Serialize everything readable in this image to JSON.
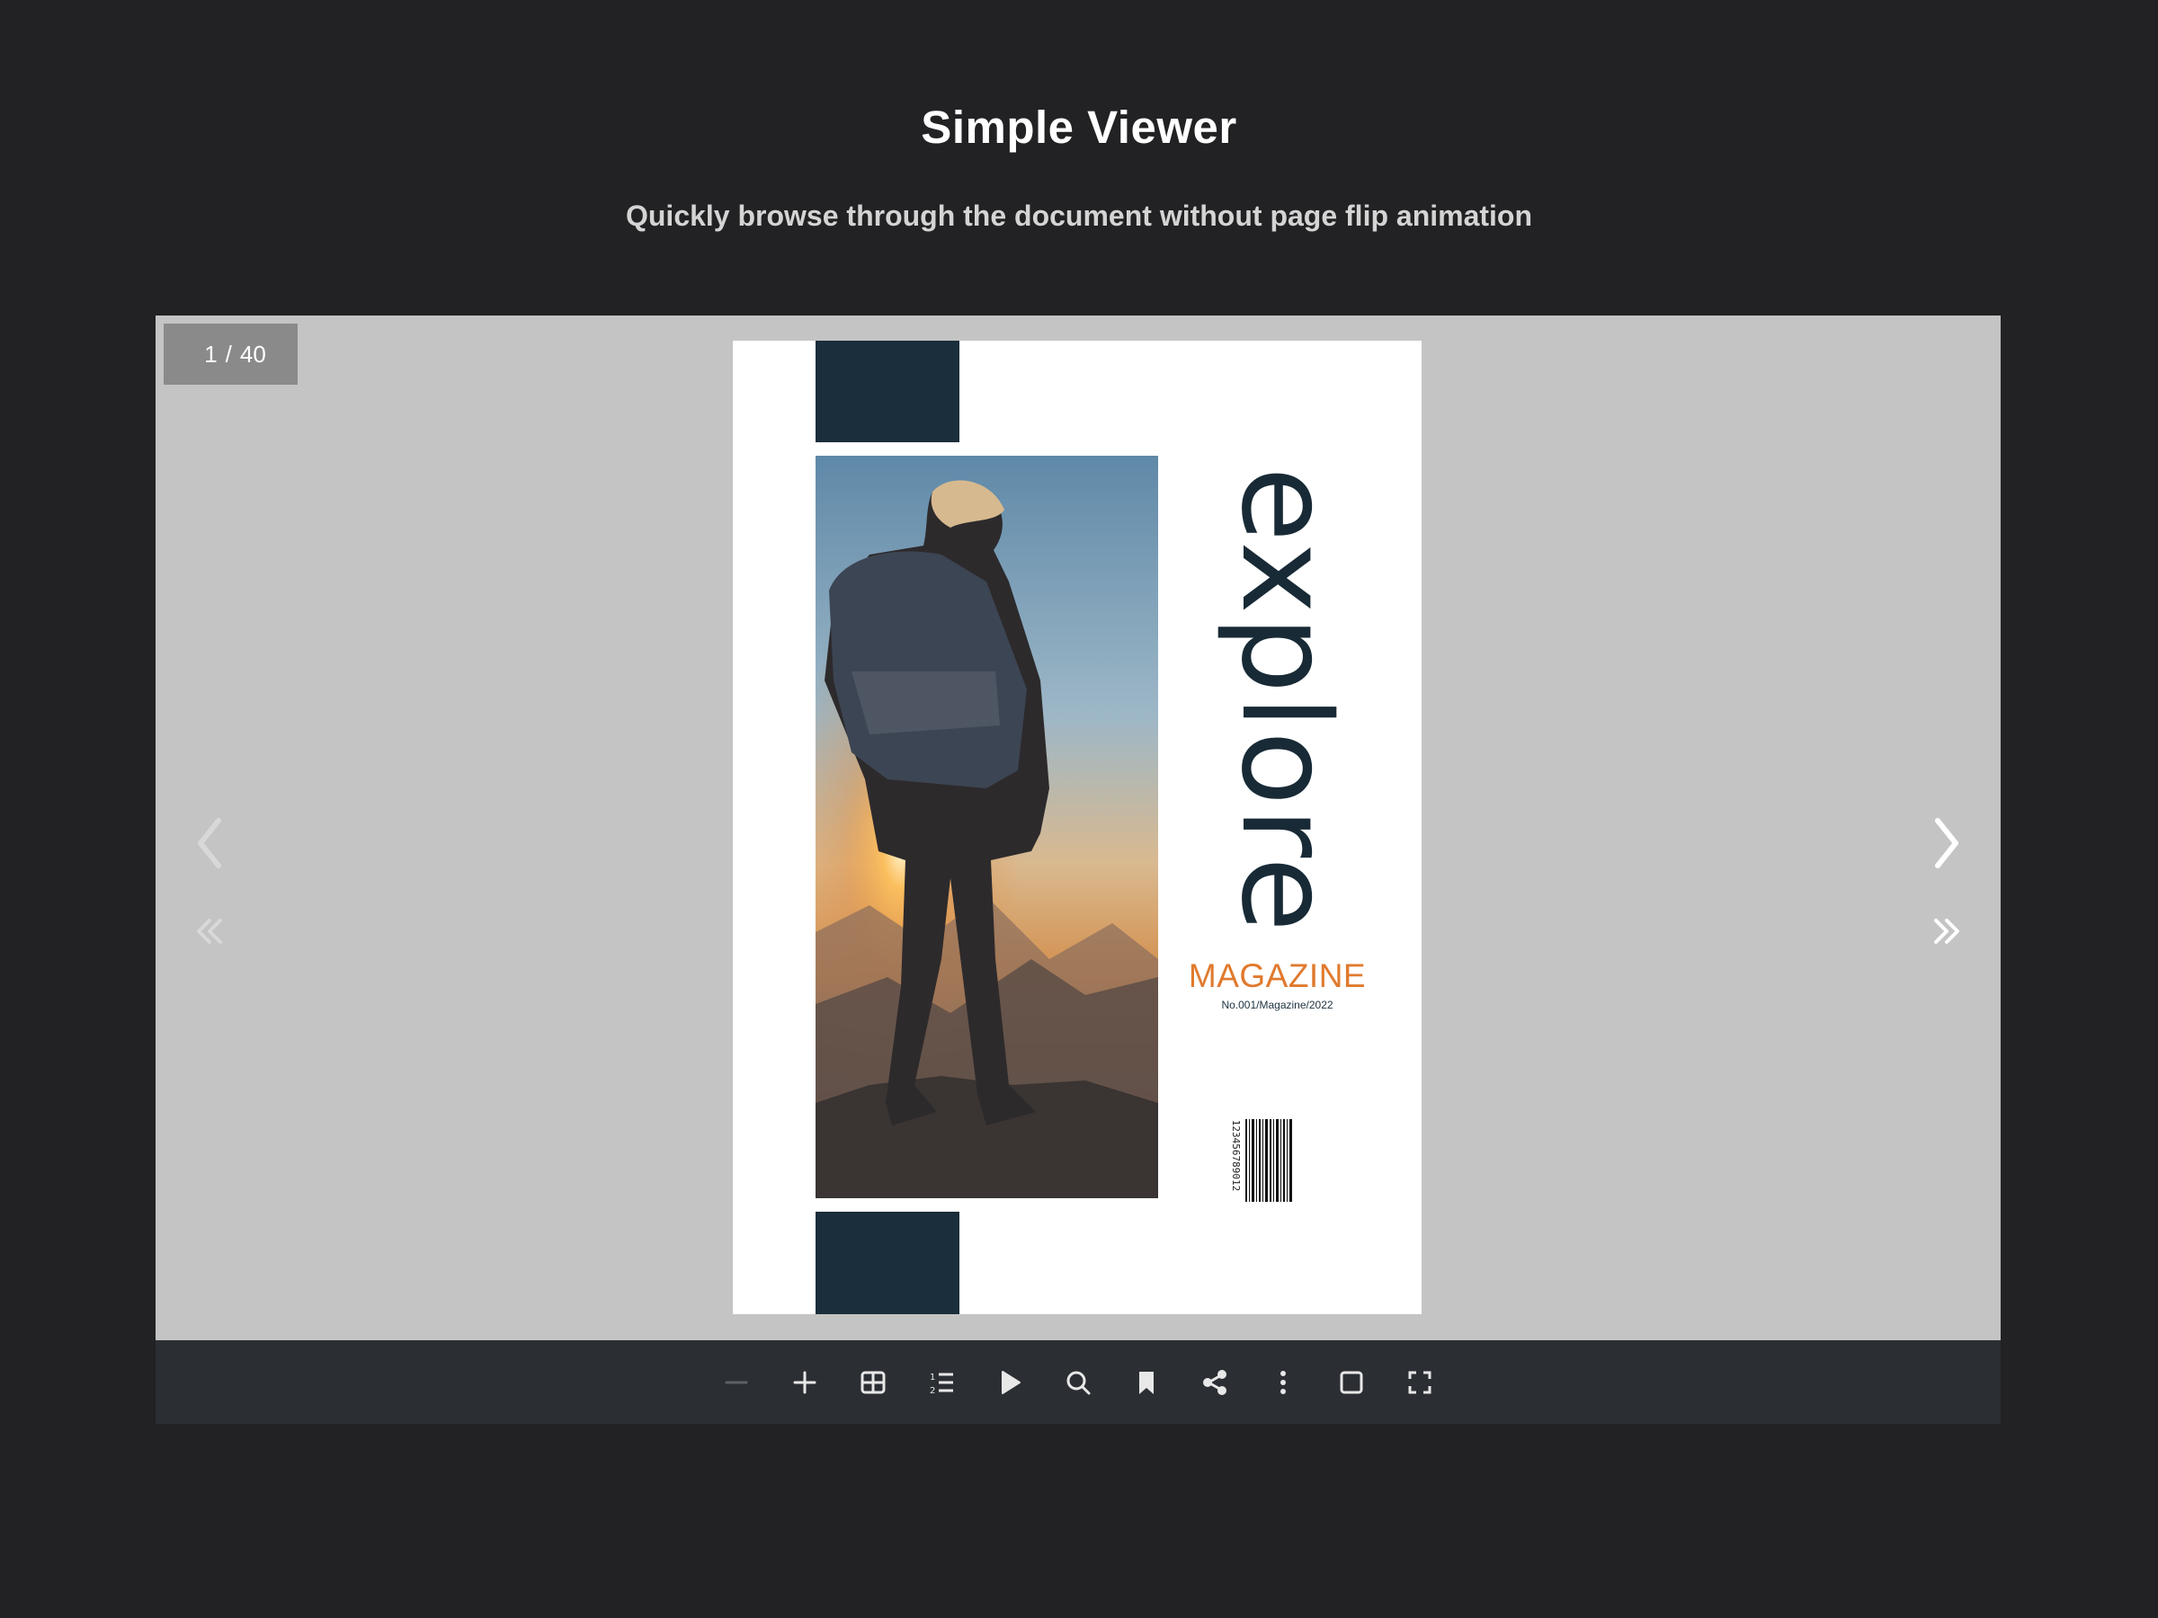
{
  "header": {
    "title": "Simple Viewer",
    "subtitle": "Quickly browse through the document without page flip animation"
  },
  "viewer": {
    "current_page": "1",
    "separator": "/",
    "total_pages": "40"
  },
  "cover": {
    "title": "explore",
    "magazine": "MAGAZINE",
    "issue": "No.001/Magazine/2022",
    "barcode_number": "123456789012"
  },
  "navigation": [
    {
      "name": "prev-page-icon",
      "enabled": false
    },
    {
      "name": "first-page-icon",
      "enabled": false
    },
    {
      "name": "next-page-icon",
      "enabled": true
    },
    {
      "name": "last-page-icon",
      "enabled": true
    }
  ],
  "toolbar": {
    "buttons": [
      {
        "name": "zoom-out-icon",
        "enabled": false
      },
      {
        "name": "zoom-in-icon",
        "enabled": true
      },
      {
        "name": "thumbnails-icon",
        "enabled": true
      },
      {
        "name": "table-of-contents-icon",
        "enabled": true
      },
      {
        "name": "autoplay-icon",
        "enabled": true
      },
      {
        "name": "search-icon",
        "enabled": true
      },
      {
        "name": "bookmark-icon",
        "enabled": true
      },
      {
        "name": "share-icon",
        "enabled": true
      },
      {
        "name": "more-options-icon",
        "enabled": true
      },
      {
        "name": "single-page-icon",
        "enabled": true
      },
      {
        "name": "fullscreen-icon",
        "enabled": true
      }
    ]
  },
  "colors": {
    "background": "#222123",
    "viewer_background": "#c4c4c4",
    "toolbar_background": "#2b2e33",
    "navy": "#1a2e3b",
    "accent_orange": "#e07a2e"
  }
}
